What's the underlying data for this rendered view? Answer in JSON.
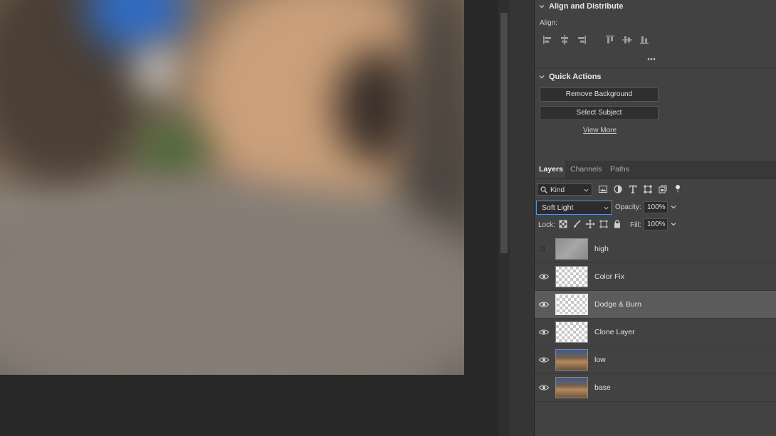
{
  "colors": {
    "panel_bg": "#424242",
    "canvas_bg": "#282828",
    "selected_row": "#5b5b5b",
    "blend_focus_border": "#6a8fc9"
  },
  "align": {
    "title": "Align and Distribute",
    "label": "Align:",
    "icons": [
      "align-left-icon",
      "align-horizontal-center-icon",
      "align-right-icon",
      "align-top-icon",
      "align-vertical-center-icon",
      "align-bottom-icon"
    ],
    "more_icon": "more-options-icon"
  },
  "quick_actions": {
    "title": "Quick Actions",
    "remove_background": "Remove Background",
    "select_subject": "Select Subject",
    "view_more": "View More"
  },
  "tabs": [
    {
      "label": "Layers",
      "active": true
    },
    {
      "label": "Channels",
      "active": false
    },
    {
      "label": "Paths",
      "active": false
    }
  ],
  "filter": {
    "kind": "Kind",
    "icons": [
      "pixel-layer-filter-icon",
      "adjustment-layer-filter-icon",
      "type-layer-filter-icon",
      "shape-layer-filter-icon",
      "smart-object-filter-icon",
      "filter-toggle-icon"
    ]
  },
  "blend": {
    "mode": "Soft Light",
    "opacity_label": "Opacity:",
    "opacity_value": "100%"
  },
  "lock": {
    "label": "Lock:",
    "icons": [
      "lock-transparent-pixels-icon",
      "lock-image-pixels-icon",
      "lock-position-icon",
      "lock-artboard-icon",
      "lock-all-icon"
    ],
    "fill_label": "Fill:",
    "fill_value": "100%"
  },
  "layers": [
    {
      "name": "high",
      "visible": false,
      "thumb": "gray",
      "selected": false
    },
    {
      "name": "Color Fix",
      "visible": true,
      "thumb": "transparent",
      "selected": false
    },
    {
      "name": "Dodge & Burn",
      "visible": true,
      "thumb": "transparent",
      "selected": true
    },
    {
      "name": "Clone Layer",
      "visible": true,
      "thumb": "transparent",
      "selected": false
    },
    {
      "name": "low",
      "visible": true,
      "thumb": "photo",
      "selected": false
    },
    {
      "name": "base",
      "visible": true,
      "thumb": "photo",
      "selected": false
    }
  ]
}
